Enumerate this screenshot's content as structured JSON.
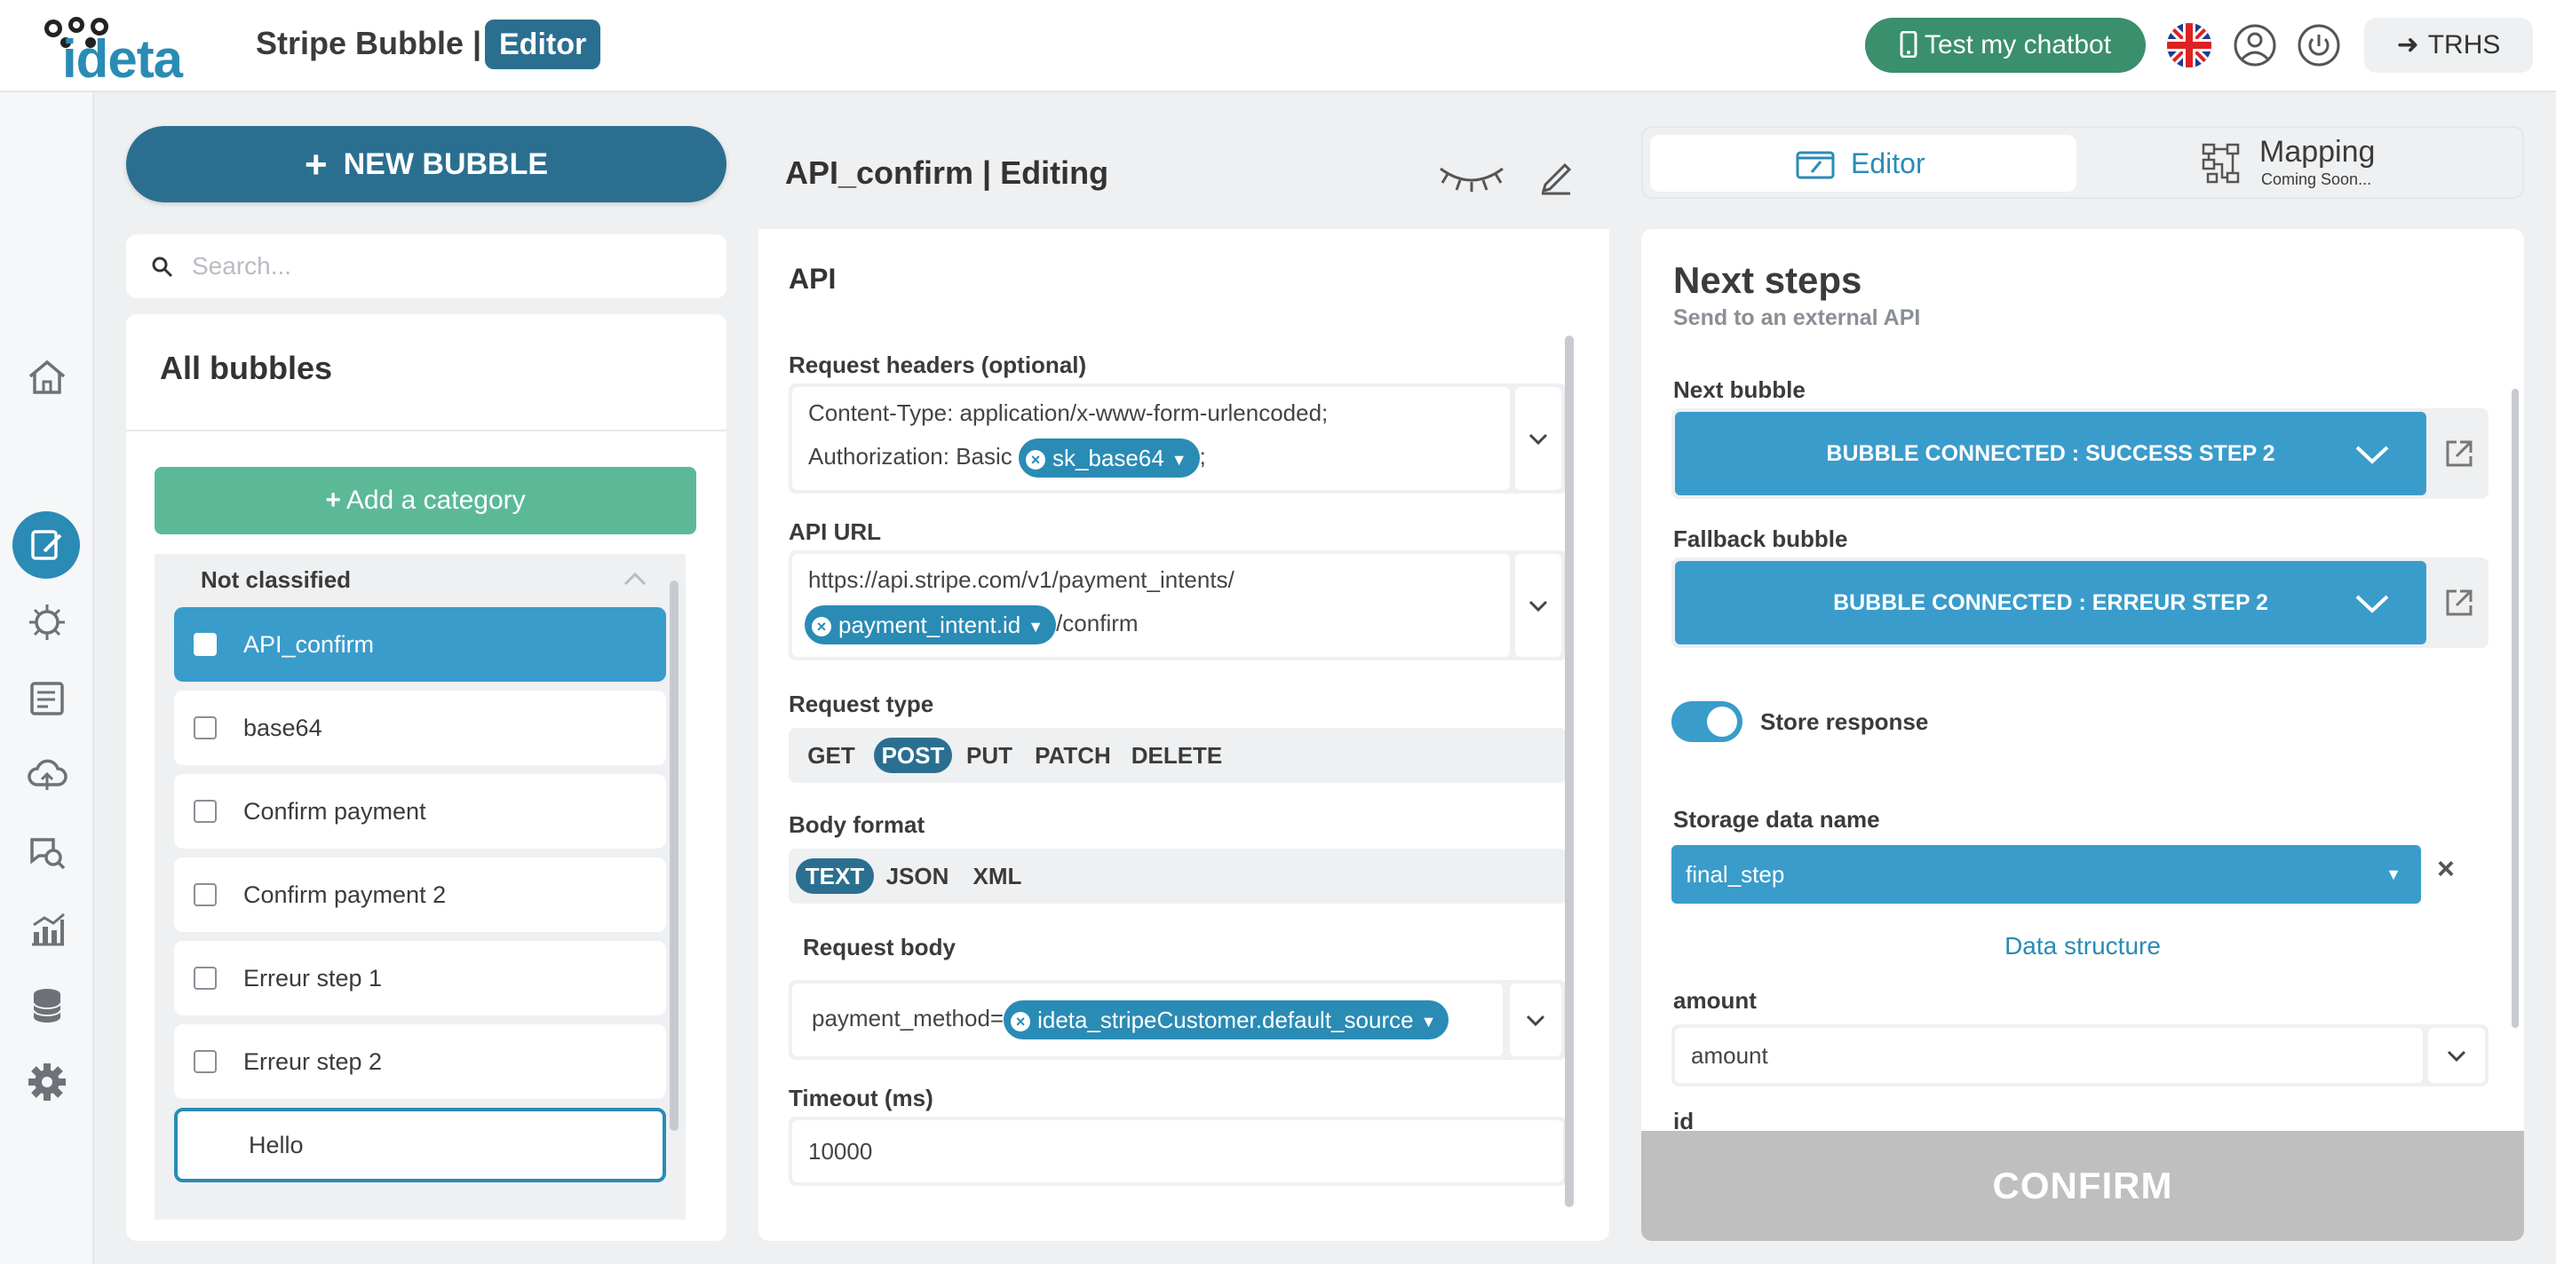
{
  "header": {
    "logo_text": "ideta",
    "project_title": "Stripe Bubble |",
    "mode_badge": "Editor",
    "test_button": "Test my chatbot",
    "user_button": "TRHS"
  },
  "icons": {
    "rail": [
      "home-icon",
      "edit-icon",
      "ai-brain-icon",
      "tasks-icon",
      "cloud-upload-icon",
      "chat-search-icon",
      "analytics-icon",
      "database-icon",
      "settings-icon"
    ]
  },
  "left": {
    "new_bubble": "NEW BUBBLE",
    "search_placeholder": "Search...",
    "panel_title": "All bubbles",
    "add_category": "Add a category",
    "category": "Not classified",
    "bubbles": [
      {
        "label": "API_confirm",
        "state": "active"
      },
      {
        "label": "base64",
        "state": "normal"
      },
      {
        "label": "Confirm payment",
        "state": "normal"
      },
      {
        "label": "Confirm payment 2",
        "state": "normal"
      },
      {
        "label": "Erreur step 1",
        "state": "normal"
      },
      {
        "label": "Erreur step 2",
        "state": "normal"
      },
      {
        "label": "Hello",
        "state": "outlined"
      }
    ]
  },
  "middle": {
    "title": "API_confirm  | Editing",
    "section": "API",
    "headers_label": "Request headers (optional)",
    "headers_line1": "Content-Type: application/x-www-form-urlencoded;",
    "headers_line2_prefix": "Authorization: Basic",
    "headers_tag": "sk_base64",
    "headers_line2_suffix": ";",
    "url_label": "API URL",
    "url_line1": "https://api.stripe.com/v1/payment_intents/",
    "url_tag": "payment_intent.id",
    "url_suffix": "/confirm",
    "type_label": "Request type",
    "types": [
      "GET",
      "POST",
      "PUT",
      "PATCH",
      "DELETE"
    ],
    "type_selected": "POST",
    "body_format_label": "Body format",
    "formats": [
      "TEXT",
      "JSON",
      "XML"
    ],
    "format_selected": "TEXT",
    "body_label": "Request body",
    "body_prefix": "payment_method=",
    "body_tag": "ideta_stripeCustomer.default_source",
    "timeout_label": "Timeout (ms)",
    "timeout_value": "10000"
  },
  "right": {
    "tab_editor": "Editor",
    "tab_mapping": "Mapping",
    "tab_mapping_sub": "Coming Soon...",
    "title": "Next steps",
    "subtitle": "Send to an external API",
    "next_label": "Next bubble",
    "next_value": "BUBBLE CONNECTED : SUCCESS STEP 2",
    "fallback_label": "Fallback bubble",
    "fallback_value": "BUBBLE CONNECTED : ERREUR STEP 2",
    "store_label": "Store response",
    "store_on": true,
    "storage_label": "Storage data name",
    "storage_value": "final_step",
    "data_structure": "Data structure",
    "amount_label": "amount",
    "amount_value": "amount",
    "id_label": "id",
    "confirm": "CONFIRM"
  },
  "colors": {
    "brand_blue": "#2a8bb5",
    "dark_blue": "#2b6f90",
    "green": "#3a8f6d",
    "category_green": "#5cb997",
    "disabled": "#bfbfbf"
  }
}
